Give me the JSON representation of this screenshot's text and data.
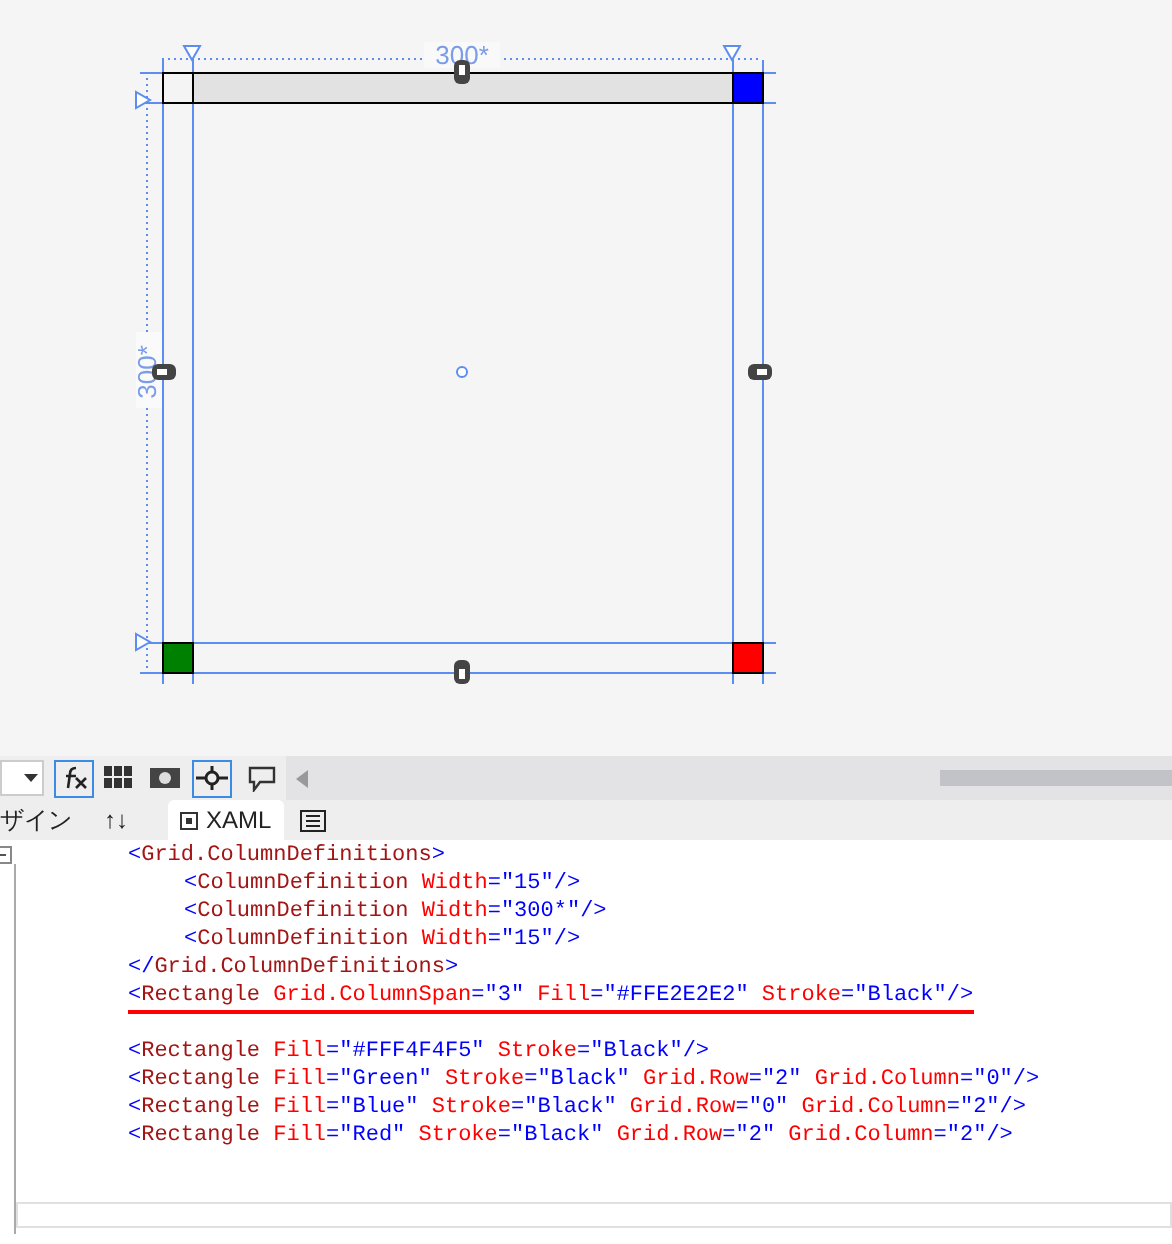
{
  "designer": {
    "column_size": "300*",
    "row_size": "300*"
  },
  "toolbar": {
    "tabs": [
      {
        "label": "ザイン",
        "kind": "text",
        "selected": false
      },
      {
        "label": "↑↓",
        "kind": "swap",
        "selected": false
      },
      {
        "label": "XAML",
        "kind": "xaml",
        "selected": true
      },
      {
        "kind": "view",
        "selected": false
      }
    ]
  },
  "code": [
    {
      "tokens": [
        {
          "kind": "punct",
          "text": "<"
        },
        {
          "kind": "tag",
          "text": "Grid.ColumnDefinitions"
        },
        {
          "kind": "punct",
          "text": ">"
        }
      ],
      "children": [
        {
          "tokens": [
            {
              "kind": "punct",
              "text": "<"
            },
            {
              "kind": "tag",
              "text": "ColumnDefinition"
            },
            {
              "kind": "attr",
              "text": " Width"
            },
            {
              "kind": "punct",
              "text": "="
            },
            {
              "kind": "value",
              "text": "\"15\""
            },
            {
              "kind": "punct",
              "text": "/>"
            }
          ]
        },
        {
          "tokens": [
            {
              "kind": "punct",
              "text": "<"
            },
            {
              "kind": "tag",
              "text": "ColumnDefinition"
            },
            {
              "kind": "attr",
              "text": " Width"
            },
            {
              "kind": "punct",
              "text": "="
            },
            {
              "kind": "value",
              "text": "\"300*\""
            },
            {
              "kind": "punct",
              "text": "/>"
            }
          ]
        },
        {
          "tokens": [
            {
              "kind": "punct",
              "text": "<"
            },
            {
              "kind": "tag",
              "text": "ColumnDefinition"
            },
            {
              "kind": "attr",
              "text": " Width"
            },
            {
              "kind": "punct",
              "text": "="
            },
            {
              "kind": "value",
              "text": "\"15\""
            },
            {
              "kind": "punct",
              "text": "/>"
            }
          ]
        }
      ]
    },
    {
      "tokens": [
        {
          "kind": "punct",
          "text": "</"
        },
        {
          "kind": "tag",
          "text": "Grid.ColumnDefinitions"
        },
        {
          "kind": "punct",
          "text": ">"
        }
      ]
    },
    {
      "underlined": true,
      "tokens": [
        {
          "kind": "punct",
          "text": "<"
        },
        {
          "kind": "tag",
          "text": "Rectangle"
        },
        {
          "kind": "attr",
          "text": " Grid.ColumnSpan"
        },
        {
          "kind": "punct",
          "text": "="
        },
        {
          "kind": "value",
          "text": "\"3\""
        },
        {
          "kind": "attr",
          "text": " Fill"
        },
        {
          "kind": "punct",
          "text": "="
        },
        {
          "kind": "value",
          "text": "\"#FFE2E2E2\""
        },
        {
          "kind": "attr",
          "text": " Stroke"
        },
        {
          "kind": "punct",
          "text": "="
        },
        {
          "kind": "value",
          "text": "\"Black\""
        },
        {
          "kind": "punct",
          "text": "/>"
        }
      ]
    },
    {
      "kind": "blank"
    },
    {
      "tokens": [
        {
          "kind": "punct",
          "text": "<"
        },
        {
          "kind": "tag",
          "text": "Rectangle"
        },
        {
          "kind": "attr",
          "text": " Fill"
        },
        {
          "kind": "punct",
          "text": "="
        },
        {
          "kind": "value",
          "text": "\"#FFF4F4F5\""
        },
        {
          "kind": "attr",
          "text": " Stroke"
        },
        {
          "kind": "punct",
          "text": "="
        },
        {
          "kind": "value",
          "text": "\"Black\""
        },
        {
          "kind": "punct",
          "text": "/>"
        }
      ]
    },
    {
      "tokens": [
        {
          "kind": "punct",
          "text": "<"
        },
        {
          "kind": "tag",
          "text": "Rectangle"
        },
        {
          "kind": "attr",
          "text": " Fill"
        },
        {
          "kind": "punct",
          "text": "="
        },
        {
          "kind": "value",
          "text": "\"Green\""
        },
        {
          "kind": "attr",
          "text": " Stroke"
        },
        {
          "kind": "punct",
          "text": "="
        },
        {
          "kind": "value",
          "text": "\"Black\""
        },
        {
          "kind": "attr",
          "text": " Grid.Row"
        },
        {
          "kind": "punct",
          "text": "="
        },
        {
          "kind": "value",
          "text": "\"2\""
        },
        {
          "kind": "attr",
          "text": " Grid.Column"
        },
        {
          "kind": "punct",
          "text": "="
        },
        {
          "kind": "value",
          "text": "\"0\""
        },
        {
          "kind": "punct",
          "text": "/>"
        }
      ]
    },
    {
      "tokens": [
        {
          "kind": "punct",
          "text": "<"
        },
        {
          "kind": "tag",
          "text": "Rectangle"
        },
        {
          "kind": "attr",
          "text": " Fill"
        },
        {
          "kind": "punct",
          "text": "="
        },
        {
          "kind": "value",
          "text": "\"Blue\""
        },
        {
          "kind": "attr",
          "text": " Stroke"
        },
        {
          "kind": "punct",
          "text": "="
        },
        {
          "kind": "value",
          "text": "\"Black\""
        },
        {
          "kind": "attr",
          "text": " Grid.Row"
        },
        {
          "kind": "punct",
          "text": "="
        },
        {
          "kind": "value",
          "text": "\"0\""
        },
        {
          "kind": "attr",
          "text": " Grid.Column"
        },
        {
          "kind": "punct",
          "text": "="
        },
        {
          "kind": "value",
          "text": "\"2\""
        },
        {
          "kind": "punct",
          "text": "/>"
        }
      ]
    },
    {
      "tokens": [
        {
          "kind": "punct",
          "text": "<"
        },
        {
          "kind": "tag",
          "text": "Rectangle"
        },
        {
          "kind": "attr",
          "text": " Fill"
        },
        {
          "kind": "punct",
          "text": "="
        },
        {
          "kind": "value",
          "text": "\"Red\""
        },
        {
          "kind": "attr",
          "text": " Stroke"
        },
        {
          "kind": "punct",
          "text": "="
        },
        {
          "kind": "value",
          "text": "\"Black\""
        },
        {
          "kind": "attr",
          "text": " Grid.Row"
        },
        {
          "kind": "punct",
          "text": "="
        },
        {
          "kind": "value",
          "text": "\"2\""
        },
        {
          "kind": "attr",
          "text": " Grid.Column"
        },
        {
          "kind": "punct",
          "text": "="
        },
        {
          "kind": "value",
          "text": "\"2\""
        },
        {
          "kind": "punct",
          "text": "/>"
        }
      ]
    }
  ]
}
